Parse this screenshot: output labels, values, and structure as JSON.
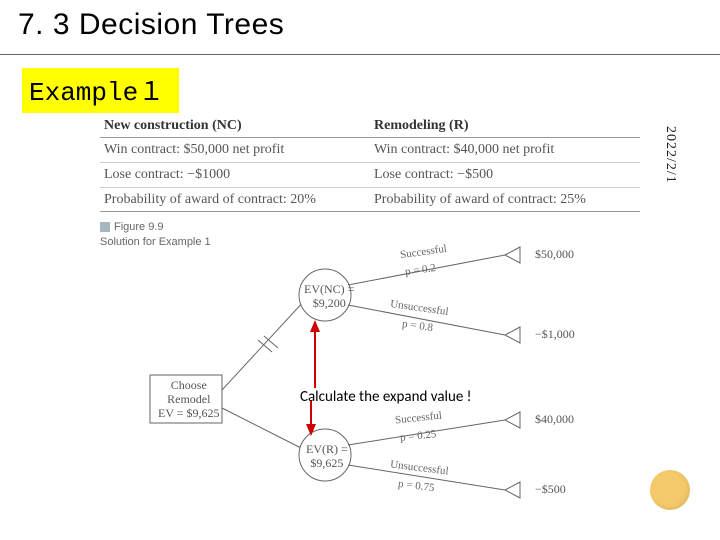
{
  "title": "7. 3 Decision Trees",
  "example_label": "Example１",
  "date_vertical": "2022/2/1",
  "table": {
    "headers": {
      "nc": "New construction (NC)",
      "r": "Remodeling (R)"
    },
    "rows": [
      {
        "nc": "Win contract: $50,000 net profit",
        "r": "Win contract: $40,000 net profit"
      },
      {
        "nc": "Lose contract: −$1000",
        "r": "Lose contract: −$500"
      },
      {
        "nc": "Probability of award of contract: 20%",
        "r": "Probability of award of contract: 25%"
      }
    ]
  },
  "figure_tag": {
    "label": "Figure 9.9",
    "caption": "Solution for Example 1"
  },
  "diagram": {
    "decision_box": {
      "l1": "Choose",
      "l2": "Remodel",
      "l3": "EV = $9,625"
    },
    "ev_nc": {
      "l1": "EV(NC) =",
      "l2": "$9,200"
    },
    "ev_r": {
      "l1": "EV(R) =",
      "l2": "$9,625"
    },
    "branches": {
      "nc_success": {
        "label": "Successful",
        "prob": "p = 0.2",
        "payoff": "$50,000"
      },
      "nc_unsuccess": {
        "label": "Unsuccessful",
        "prob": "p = 0.8",
        "payoff": "−$1,000"
      },
      "r_success": {
        "label": "Successful",
        "prob": "p = 0.25",
        "payoff": "$40,000"
      },
      "r_unsuccess": {
        "label": "Unsuccessful",
        "prob": "p = 0.75",
        "payoff": "−$500"
      }
    }
  },
  "callout": "Calculate the expand value !"
}
